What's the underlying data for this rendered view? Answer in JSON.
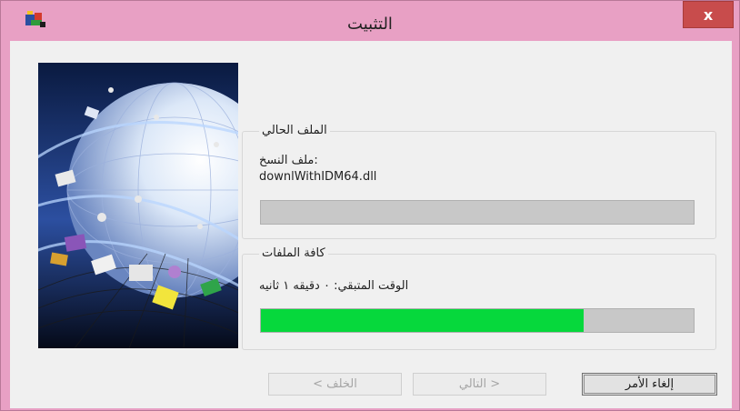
{
  "window": {
    "title": "التثبيت"
  },
  "current_file": {
    "group_label": "الملف الحالي",
    "action_label": ":ملف النسخ",
    "file_name": "downlWithIDM64.dll",
    "progress": 0
  },
  "all_files": {
    "group_label": "كافة الملفات",
    "time_remaining": "الوقت المتبقي: ٠ دقيقه ١ ثانيه",
    "progress": 0.745
  },
  "buttons": {
    "back": "الخلف >",
    "next": "< التالي",
    "cancel": "إلغاء الأمر",
    "close": "x"
  },
  "colors": {
    "titlebar": "#e8a0c4",
    "progress_fill": "#06d83c",
    "progress_track": "#c8c8c8",
    "close_button": "#c84c4c"
  },
  "icons": {
    "app": "installer-app-icon",
    "close": "close-icon"
  }
}
